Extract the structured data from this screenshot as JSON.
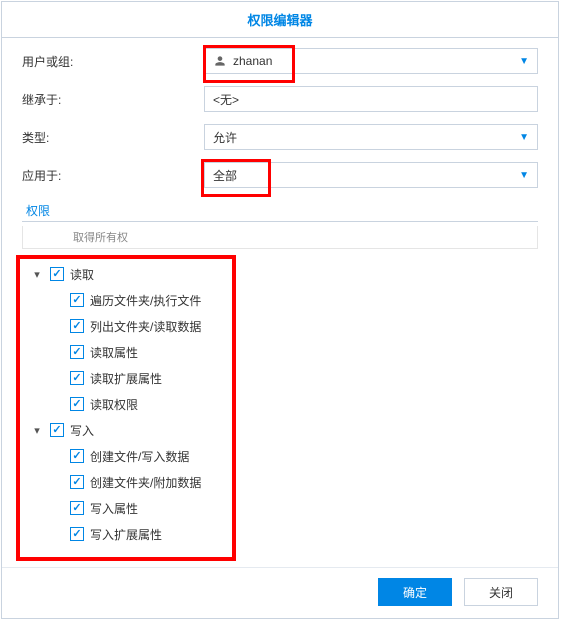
{
  "title": "权限编辑器",
  "form": {
    "user_label": "用户或组:",
    "user_value": "zhanan",
    "inherit_label": "继承于:",
    "inherit_value": "<无>",
    "type_label": "类型:",
    "type_value": "允许",
    "apply_label": "应用于:",
    "apply_value": "全部"
  },
  "perm_section_label": "权限",
  "cut_row_text": "取得所有权",
  "tree": {
    "read": {
      "label": "读取",
      "children": [
        "遍历文件夹/执行文件",
        "列出文件夹/读取数据",
        "读取属性",
        "读取扩展属性",
        "读取权限"
      ]
    },
    "write": {
      "label": "写入",
      "children": [
        "创建文件/写入数据",
        "创建文件夹/附加数据",
        "写入属性",
        "写入扩展属性"
      ]
    }
  },
  "buttons": {
    "ok": "确定",
    "close": "关闭"
  }
}
